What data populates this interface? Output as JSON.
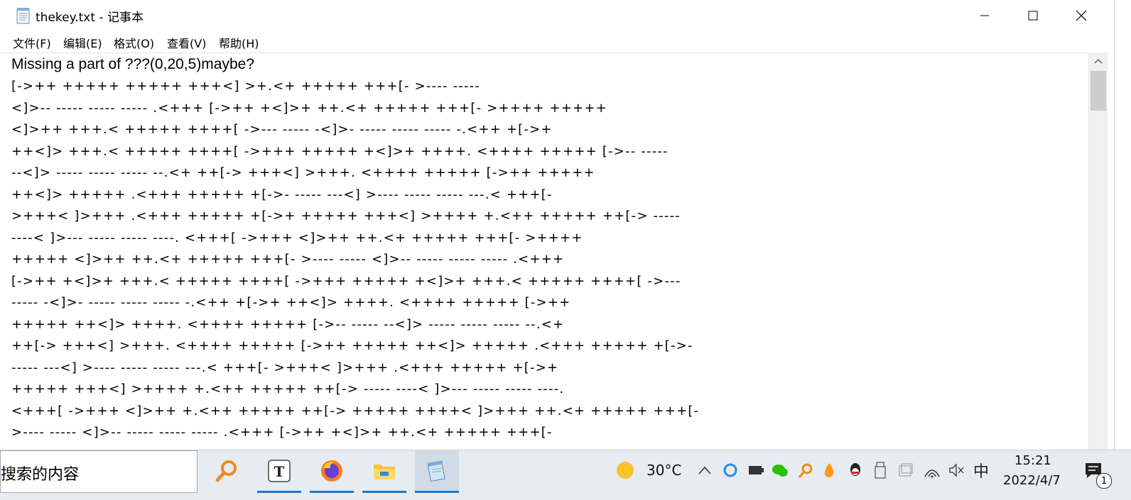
{
  "window": {
    "title": "thekey.txt - 记事本",
    "icon": "notepad-icon"
  },
  "menu": [
    {
      "label": "文件(F)"
    },
    {
      "label": "编辑(E)"
    },
    {
      "label": "格式(O)"
    },
    {
      "label": "查看(V)"
    },
    {
      "label": "帮助(H)"
    }
  ],
  "editor": {
    "first_line": "Missing a part of ???(0,20,5)maybe?",
    "lines": [
      "[->++ +++++ +++++ +++<] >+.<+ +++++ +++[- >---- -----",
      "<]>-- ----- ----- ----- .<+++ [->++ +<]>+ ++.<+ +++++ +++[- >++++ +++++",
      "<]>++ +++.< +++++ ++++[ ->--- ----- -<]>- ----- ----- ----- -.<++ +[->+",
      "++<]> +++.< +++++ ++++[ ->+++ +++++ +<]>+ ++++. <++++ +++++ [->-- -----",
      "--<]> ----- ----- ----- --.<+ ++[-> +++<] >+++. <++++ +++++ [->++ +++++",
      "++<]> +++++ .<+++ +++++ +[->- ----- ---<] >---- ----- ----- ---.< +++[-",
      ">+++< ]>+++ .<+++ +++++ +[->+ +++++ +++<] >++++ +.<++ +++++ ++[-> -----",
      "----< ]>--- ----- ----- ----. <+++[ ->+++ <]>++ ++.<+ +++++ +++[- >++++",
      "+++++ <]>++ ++.<+ +++++ +++[- >---- ----- <]>-- ----- ----- ----- .<+++",
      "[->++ +<]>+ +++.< +++++ ++++[ ->+++ +++++ +<]>+ +++.< +++++ ++++[ ->---",
      "----- -<]>- ----- ----- ----- -.<++ +[->+ ++<]> ++++. <++++ +++++ [->++",
      "+++++ ++<]> ++++. <++++ +++++ [->-- ----- --<]> ----- ----- ----- --.<+",
      "++[-> +++<] >+++. <++++ +++++ [->++ +++++ ++<]> +++++ .<+++ +++++ +[->-",
      "----- ---<] >---- ----- ----- ---.< +++[- >+++< ]>+++ .<+++ +++++ +[->+",
      "+++++ +++<] >++++ +.<++ +++++ ++[-> ----- ----< ]>--- ----- ----- ----.",
      "<+++[ ->+++ <]>++ +.<++ +++++ ++[-> +++++ ++++< ]>+++ ++.<+ +++++ +++[-",
      ">---- ----- <]>-- ----- ----- ----- .<+++ [->++ +<]>+ ++.<+ +++++ +++[-"
    ]
  },
  "taskbar": {
    "search_text": "搜索的内容",
    "weather_temp": "30°C",
    "ime": "中",
    "time": "15:21",
    "date": "2022/4/7",
    "notification_count": "1"
  },
  "colors": {
    "accent": "#1979ca",
    "taskbar_bg": "#e7ecf3"
  }
}
